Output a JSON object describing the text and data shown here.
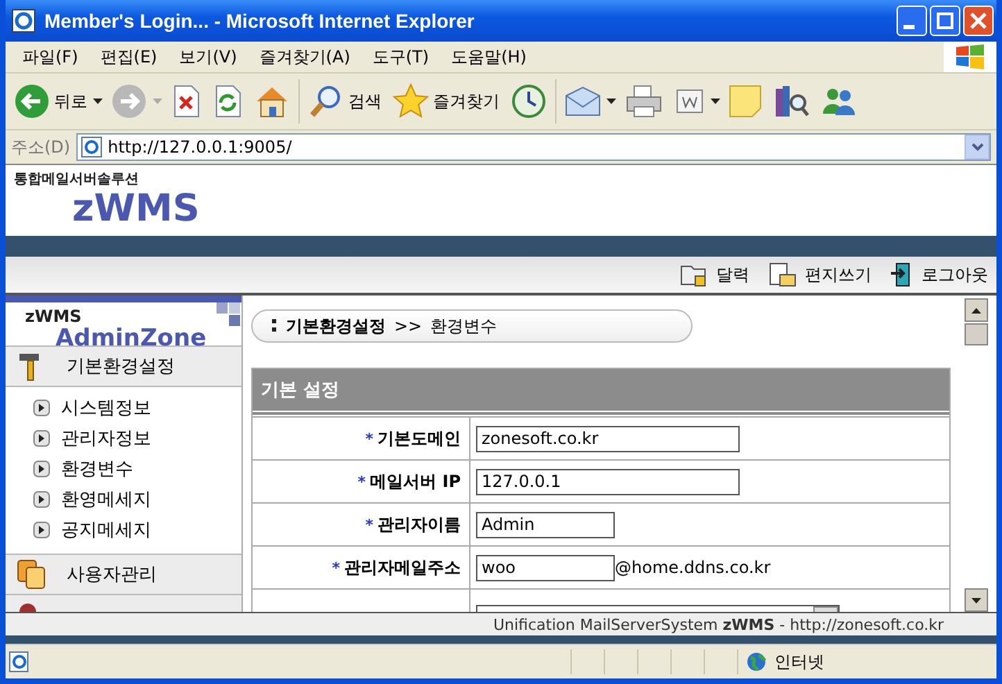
{
  "window": {
    "title": "Member's Login... - Microsoft Internet Explorer"
  },
  "menu": [
    "파일(F)",
    "편집(E)",
    "보기(V)",
    "즐겨찾기(A)",
    "도구(T)",
    "도움말(H)"
  ],
  "toolbar": [
    {
      "kind": "back",
      "label": "뒤로",
      "dropdown": true
    },
    {
      "kind": "forward",
      "dropdown": true
    },
    {
      "kind": "stop"
    },
    {
      "kind": "refresh"
    },
    {
      "kind": "home"
    },
    {
      "kind": "search",
      "label": "검색"
    },
    {
      "kind": "favorites",
      "label": "즐겨찾기"
    },
    {
      "kind": "history"
    },
    {
      "kind": "mail",
      "dropdown": true
    },
    {
      "kind": "print"
    },
    {
      "kind": "edit",
      "dropdown": true
    },
    {
      "kind": "note"
    },
    {
      "kind": "research"
    },
    {
      "kind": "messenger"
    }
  ],
  "address": {
    "label": "주소(D)",
    "value": "http://127.0.0.1:9005/"
  },
  "site": {
    "tagline": "통합메일서버솔루션",
    "logo": "zWMS",
    "top_links": [
      {
        "kind": "calendar",
        "label": "달력"
      },
      {
        "kind": "compose",
        "label": "편지쓰기"
      },
      {
        "kind": "logout",
        "label": "로그아웃"
      }
    ]
  },
  "sidebar": {
    "brand": "zWMS",
    "zone": "AdminZone",
    "sections": [
      {
        "kind": "tools",
        "label": "기본환경설정",
        "children": [
          {
            "label": "시스템정보"
          },
          {
            "label": "관리자정보"
          },
          {
            "label": "환경변수"
          },
          {
            "label": "환영메세지"
          },
          {
            "label": "공지메세지"
          }
        ]
      },
      {
        "kind": "users",
        "label": "사용자관리"
      }
    ]
  },
  "breadcrumb": {
    "parent": "기본환경설정",
    "separator": ">>",
    "current": "환경변수"
  },
  "form": {
    "title": "기본 설정",
    "rows": [
      {
        "kind": "text",
        "mark": "*",
        "label": "기본도메인",
        "value": "zonesoft.co.kr",
        "wide": true
      },
      {
        "kind": "text",
        "mark": "*",
        "label": "메일서버 IP",
        "value": "127.0.0.1",
        "wide": true
      },
      {
        "kind": "text",
        "mark": "*",
        "label": "관리자이름",
        "value": "Admin",
        "wide": false
      },
      {
        "kind": "text",
        "mark": "*",
        "label": "관리자메일주소",
        "value": "woo",
        "suffix": "@home.ddns.co.kr",
        "wide": false
      },
      {
        "kind": "textarea"
      }
    ]
  },
  "footer": "Unification MailServerSystem **zWMS**  -  http://zonesoft.co.kr",
  "status_bar": {
    "zone": "인터넷"
  }
}
